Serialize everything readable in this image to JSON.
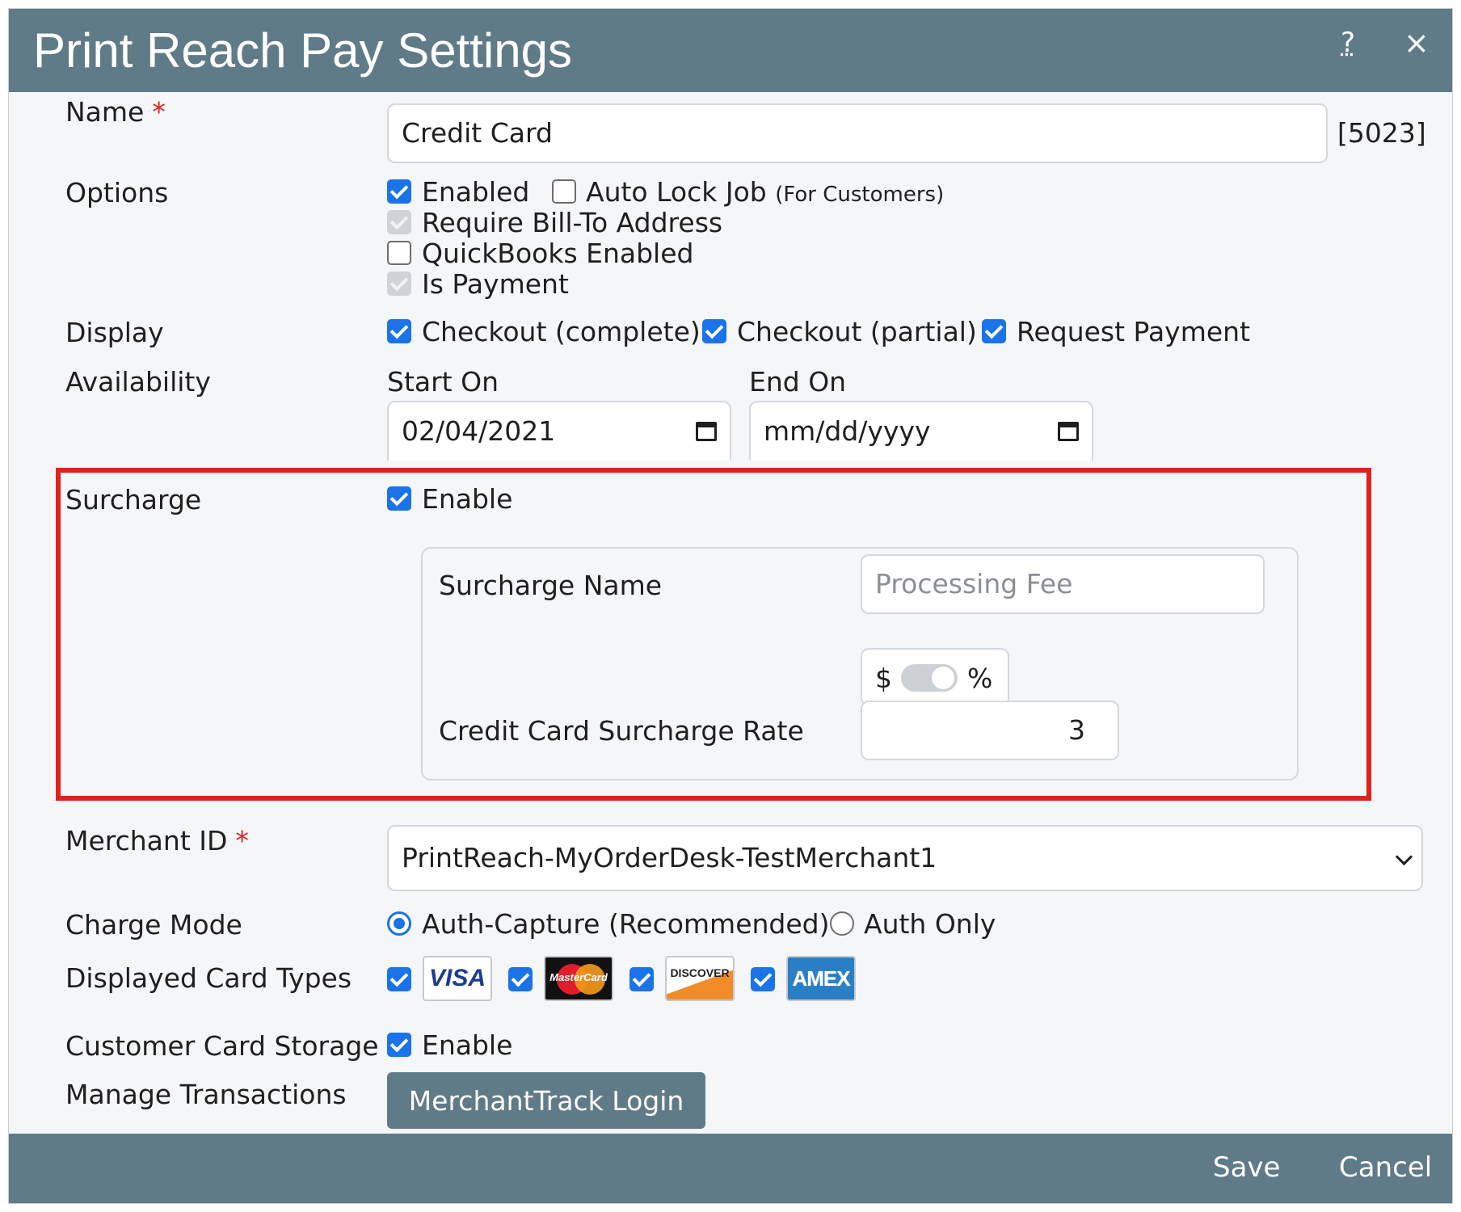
{
  "dialog": {
    "title": "Print Reach Pay Settings",
    "help_label": "?",
    "close_label": "×"
  },
  "name": {
    "label": "Name",
    "required_mark": "*",
    "value": "Credit Card",
    "id_tag": "[5023]"
  },
  "options": {
    "label": "Options",
    "enabled_label": "Enabled",
    "auto_lock_label": "Auto Lock Job",
    "auto_lock_note": "(For Customers)",
    "require_bill_to_label": "Require Bill-To Address",
    "quickbooks_label": "QuickBooks Enabled",
    "is_payment_label": "Is Payment"
  },
  "display": {
    "label": "Display",
    "checkout_complete_label": "Checkout (complete)",
    "checkout_partial_label": "Checkout (partial)",
    "request_payment_label": "Request Payment"
  },
  "availability": {
    "label": "Availability",
    "start_label": "Start On",
    "start_value": "02/04/2021",
    "end_label": "End On",
    "end_placeholder": "mm/dd/yyyy"
  },
  "surcharge": {
    "label": "Surcharge",
    "enable_label": "Enable",
    "name_label": "Surcharge Name",
    "name_placeholder": "Processing Fee",
    "toggle_left": "$",
    "toggle_right": "%",
    "rate_label": "Credit Card Surcharge Rate",
    "rate_value": "3"
  },
  "merchant": {
    "label": "Merchant ID",
    "required_mark": "*",
    "selected": "PrintReach-MyOrderDesk-TestMerchant1"
  },
  "charge_mode": {
    "label": "Charge Mode",
    "auth_capture_label": "Auth-Capture (Recommended)",
    "auth_only_label": "Auth Only"
  },
  "card_types": {
    "label": "Displayed Card Types",
    "visa": "VISA",
    "mastercard": "MasterCard",
    "discover": "DISCOVER",
    "amex": "AMEX"
  },
  "card_storage": {
    "label": "Customer Card Storage",
    "enable_label": "Enable"
  },
  "transactions": {
    "label": "Manage Transactions",
    "button_label": "MerchantTrack Login"
  },
  "footer": {
    "save_label": "Save",
    "cancel_label": "Cancel"
  },
  "colors": {
    "header": "#607b88",
    "accent": "#1a73e8",
    "highlight": "#e0221a",
    "required": "#e02020"
  }
}
